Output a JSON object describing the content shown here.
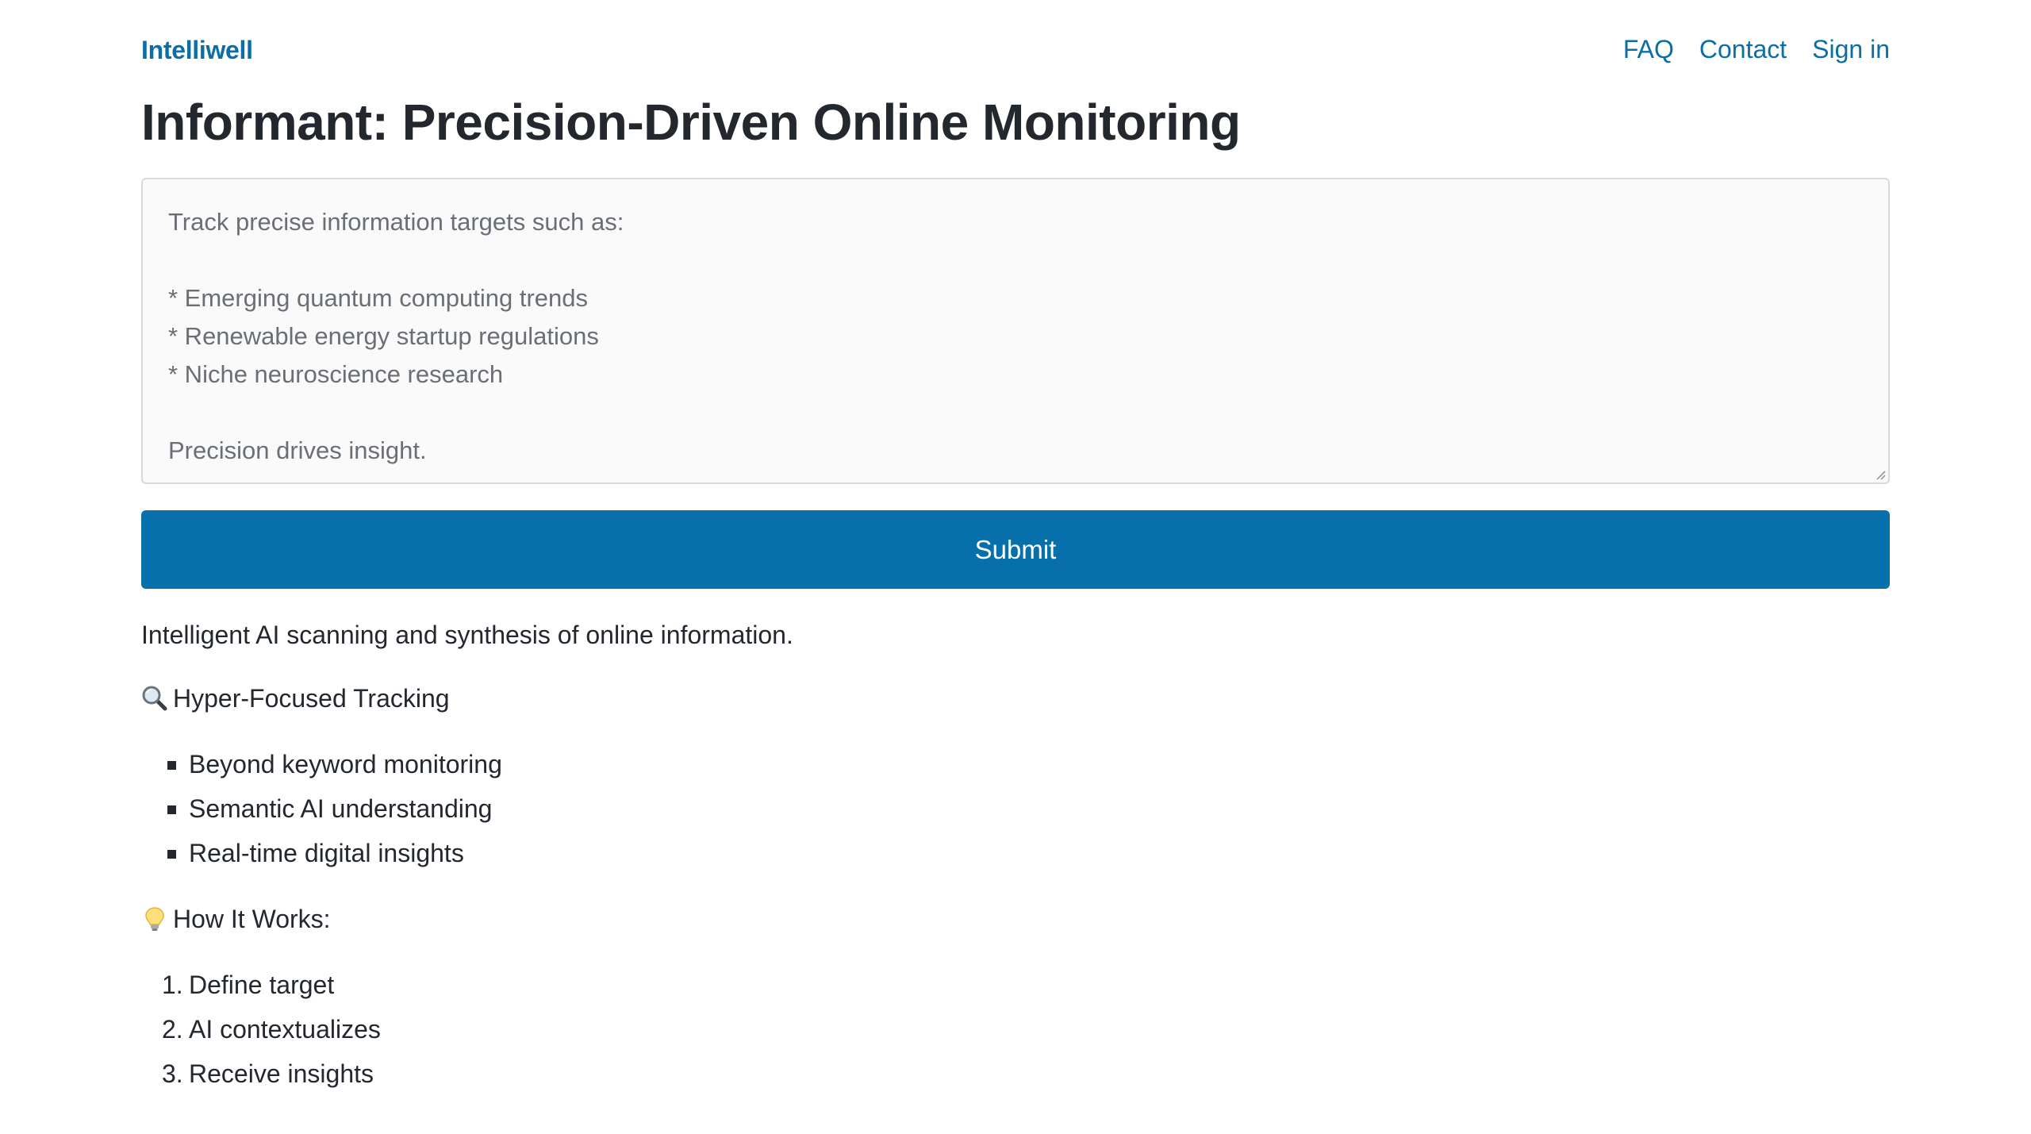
{
  "nav": {
    "brand": "Intelliwell",
    "links": [
      "FAQ",
      "Contact",
      "Sign in"
    ]
  },
  "page_title": "Informant: Precision-Driven Online Monitoring",
  "prompt": {
    "value": "Track precise information targets such as:\n\n* Emerging quantum computing trends\n* Renewable energy startup regulations\n* Niche neuroscience research\n\nPrecision drives insight."
  },
  "submit_label": "Submit",
  "tagline": "Intelligent AI scanning and synthesis of online information.",
  "features": {
    "icon": "magnifying-glass-icon",
    "heading": "Hyper-Focused Tracking",
    "items": [
      "Beyond keyword monitoring",
      "Semantic AI understanding",
      "Real-time digital insights"
    ]
  },
  "how_it_works": {
    "icon": "lightbulb-icon",
    "heading": "How It Works:",
    "steps": [
      "Define target",
      "AI contextualizes",
      "Receive insights"
    ],
    "numbers": [
      "1.",
      "2.",
      "3."
    ]
  },
  "colors": {
    "brand": "#0b6ea5",
    "button": "#0770ab",
    "text": "#23282e",
    "placeholder_text": "#6a6f75"
  }
}
